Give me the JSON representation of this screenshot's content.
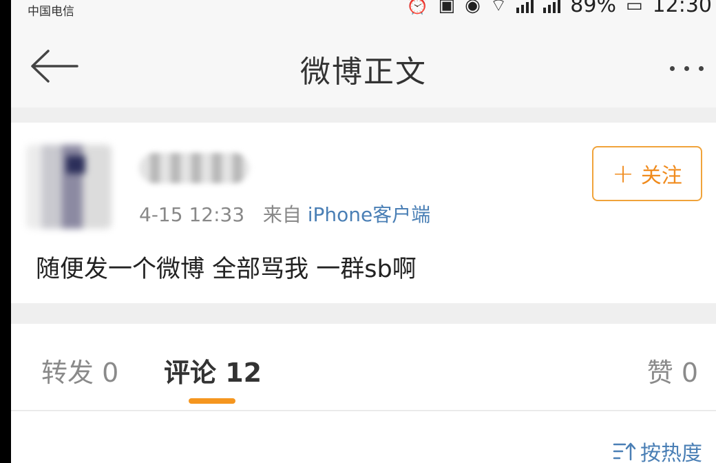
{
  "status_bar": {
    "carrier": "中国电信",
    "battery": "89%",
    "time": "12:30"
  },
  "nav": {
    "title": "微博正文"
  },
  "post": {
    "date": "4-15 12:33",
    "source_prefix": "来自",
    "source": "iPhone客户端",
    "follow_label": "关注",
    "text": "随便发一个微博 全部骂我 一群sb啊"
  },
  "tabs": {
    "reposts": "转发 0",
    "comments": "评论 12",
    "likes": "赞 0"
  },
  "sort": {
    "label": "按热度"
  },
  "colors": {
    "accent": "#f5961f",
    "link": "#4a7fb5"
  }
}
